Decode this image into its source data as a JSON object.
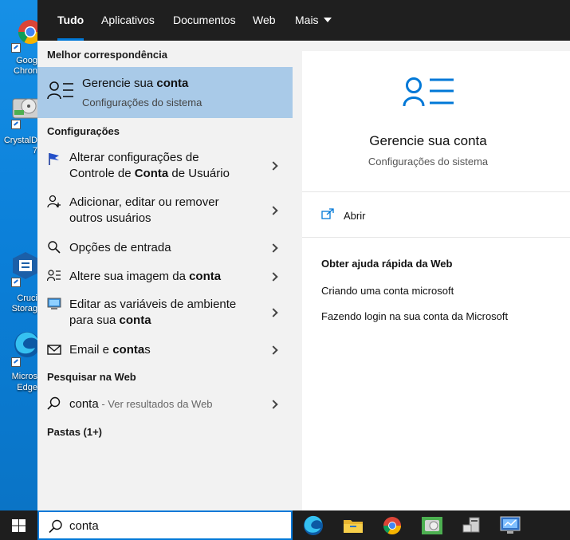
{
  "desktop": {
    "icons": [
      {
        "name": "chrome",
        "lines": [
          "Goog",
          "Chron"
        ]
      },
      {
        "name": "crystaldisk",
        "lines": [
          "CrystalD",
          "7"
        ]
      },
      {
        "name": "crucial",
        "lines": [
          "Cruci",
          "Storag"
        ]
      },
      {
        "name": "edge",
        "lines": [
          "Micros",
          "Edge"
        ]
      }
    ]
  },
  "tabs": {
    "all": "Tudo",
    "apps": "Aplicativos",
    "docs": "Documentos",
    "web": "Web",
    "more": "Mais"
  },
  "left": {
    "best_match_header": "Melhor correspondência",
    "best_match": {
      "title_pre": "Gerencie sua ",
      "title_bold": "conta",
      "subtitle": "Configurações do sistema"
    },
    "settings_header": "Configurações",
    "settings": [
      {
        "line1": "Alterar configurações de",
        "line2_pre": "Controle de ",
        "line2_bold": "Conta",
        "line2_post": " de Usuário"
      },
      {
        "line1": "Adicionar, editar ou remover",
        "line2": "outros usuários"
      },
      {
        "text": "Opções de entrada"
      },
      {
        "pre": "Altere sua imagem da ",
        "bold": "conta"
      },
      {
        "line1": "Editar as variáveis de ambiente",
        "line2_pre": "para sua ",
        "line2_bold": "conta"
      },
      {
        "pre": "Email e ",
        "bold": "conta",
        "post": "s"
      }
    ],
    "web_header": "Pesquisar na Web",
    "web_item": {
      "query": "conta",
      "suffix": " - Ver resultados da Web"
    },
    "folders_header": "Pastas (1+)"
  },
  "right": {
    "title": "Gerencie sua conta",
    "subtitle": "Configurações do sistema",
    "open_label": "Abrir",
    "help_header": "Obter ajuda rápida da Web",
    "help_links": [
      "Criando uma conta microsoft",
      "Fazendo login na sua conta da Microsoft"
    ]
  },
  "search": {
    "value": "conta"
  },
  "colors": {
    "accent": "#0078d7",
    "selected": "#a9cae8",
    "tabbar": "#1f1f1f"
  }
}
